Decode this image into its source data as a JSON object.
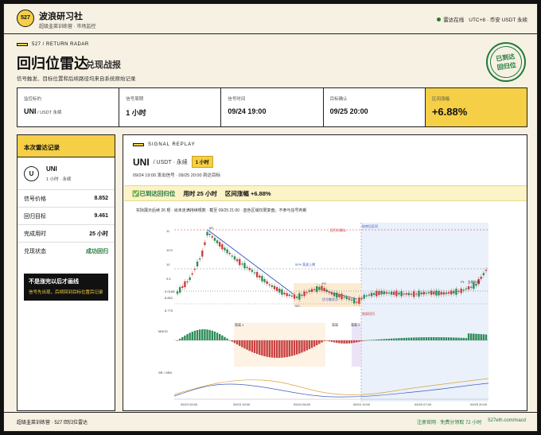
{
  "header": {
    "logo": "527",
    "brand": "波浪研习社",
    "brand_sub": "超级韭菜训练营 · 市场监控",
    "status": "雷达在线",
    "tz": "UTC+8 · 币安 USDT 永续"
  },
  "page": {
    "tag": "527 / RETURN RADAR",
    "title": "回归位雷达",
    "title_sub": "兑现战报",
    "subline": "信号触发、目标位置和后续路径均来自系统原始记录",
    "stamp": [
      "已到达",
      "回归位"
    ]
  },
  "stats": [
    {
      "label": "监控标的",
      "value": "UNI",
      "suffix": " / USDT 永续"
    },
    {
      "label": "信号周期",
      "value": "1 小时"
    },
    {
      "label": "信号时间",
      "value": "09/24 19:00"
    },
    {
      "label": "目标确认",
      "value": "09/25 20:00"
    },
    {
      "label": "区间涨幅",
      "value": "+6.88%"
    }
  ],
  "side": {
    "head": "本次雷达记录",
    "coin_letter": "U",
    "coin": "UNI",
    "coin_sub": "1 小时 · 永续",
    "rows": [
      {
        "k": "信号价格",
        "v": "8.852"
      },
      {
        "k": "回归目标",
        "v": "9.461"
      },
      {
        "k": "完成用时",
        "v": "25 小时"
      },
      {
        "k": "兑现状态",
        "v": "成功回归"
      }
    ],
    "warn_title": "不是涨完以后才画线",
    "warn_sub": "信号先出现，后续回到目标位置后记录"
  },
  "main": {
    "tag": "SIGNAL REPLAY",
    "pair": "UNI",
    "pair_sub": "/ USDT · 永续",
    "pill": "1 小时",
    "time_line": "09/24 19:00 发出信号 · 09/25 20:00 到达目标",
    "result": [
      "✅已到达回归位",
      "用时 25 小时",
      "区间涨幅 +6.88%"
    ],
    "note": "实际展示后续 26 根 · 尚未走满持续根数 · 截至 09/25 21:00 · 蓝色区域仅限复盘，不参与信号判断"
  },
  "chart_labels": {
    "y_ticks": [
      "11",
      "10.5",
      "10",
      "9.5",
      "9.0185",
      "8.852",
      "8.775"
    ],
    "x_ticks": [
      "09/23 05:00",
      "09/23 19:00",
      "09/24 06:00",
      "09/24 19:00",
      "09/25 07:00",
      "09/25 20:00"
    ],
    "macd": "MACD",
    "obv": "SR / OBV",
    "ann": [
      "结束后区间",
      "回归位确认",
      "50% 斐波上摊",
      "M1",
      "P2",
      "M3",
      "P1 · 当前价格",
      "信号触发点",
      "底部回归",
      "背离 1",
      "背离",
      "背离 2"
    ]
  },
  "footer": {
    "left": "超级韭菜训练营 · 527 回归位雷达",
    "right1": "注册官网 · 免费分领取 72 小时",
    "right2": "527eth.com/macd"
  }
}
